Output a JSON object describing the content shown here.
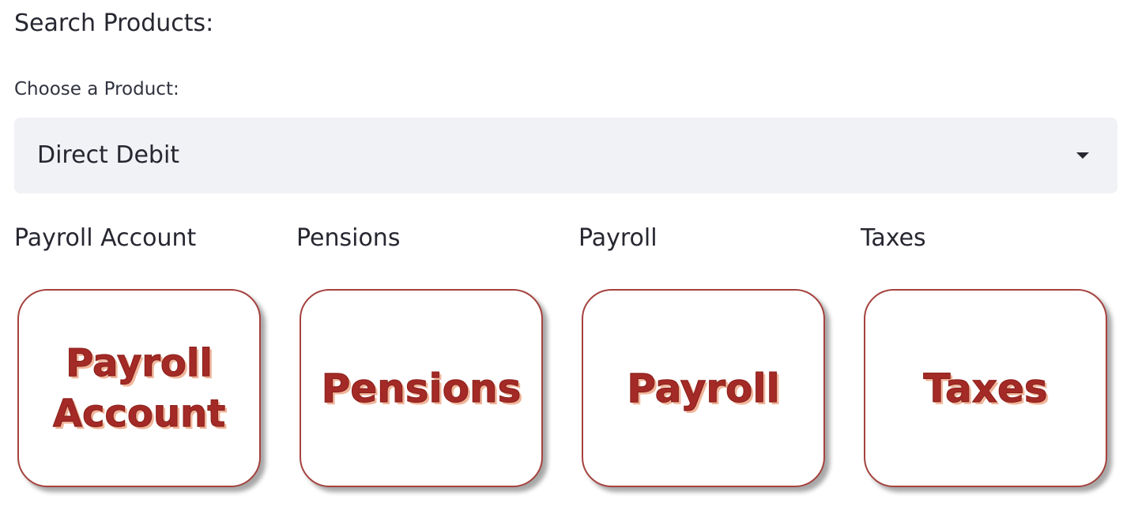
{
  "header": {
    "title": "Search Products:"
  },
  "select": {
    "label": "Choose a Product:",
    "value": "Direct Debit",
    "caret_icon": "caret-down-icon"
  },
  "products": [
    {
      "title": "Payroll Account",
      "tile_text": "Payroll\nAccount"
    },
    {
      "title": "Pensions",
      "tile_text": "Pensions"
    },
    {
      "title": "Payroll",
      "tile_text": "Payroll"
    },
    {
      "title": "Taxes",
      "tile_text": "Taxes"
    }
  ],
  "colors": {
    "accent": "#a32a26",
    "select_bg": "#f0f2f6",
    "text": "#262730"
  }
}
